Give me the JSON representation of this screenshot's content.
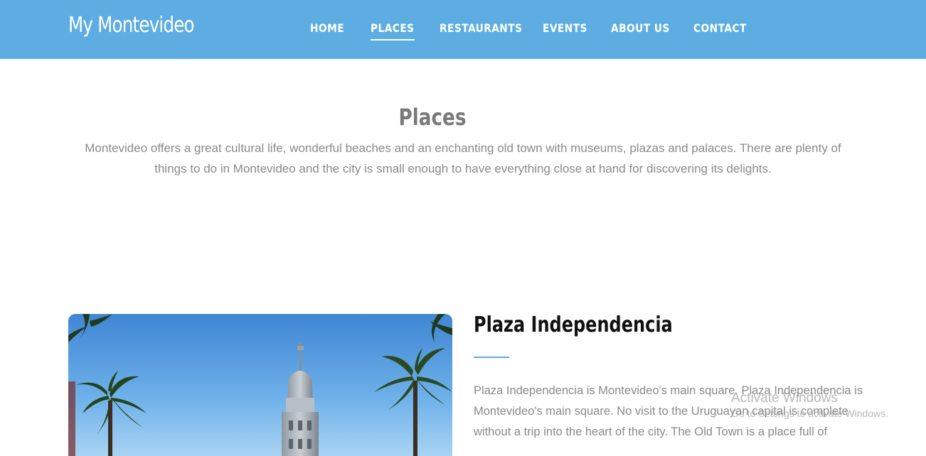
{
  "brand": "My Montevideo",
  "nav": [
    {
      "label": "HOME",
      "active": false
    },
    {
      "label": "PLACES",
      "active": true
    },
    {
      "label": "RESTAURANTS",
      "active": false
    },
    {
      "label": "EVENTS",
      "active": false
    },
    {
      "label": "ABOUT US",
      "active": false
    },
    {
      "label": "CONTACT",
      "active": false
    }
  ],
  "section": {
    "title": "Places",
    "intro": "Montevideo offers a great cultural life, wonderful beaches and an enchanting old town with museums, plazas and palaces. There are plenty of things to do in Montevideo and the city is small enough to have everything close at hand for discovering its delights."
  },
  "place": {
    "title": "Plaza Independencia",
    "description": "Plaza Independencia is Montevideo's main square. Plaza Independencia is Montevideo's main square. No visit to the Uruguayan capital is complete without a trip into the heart of the city. The Old Town is a place full of"
  },
  "watermark": {
    "title": "Activate Windows",
    "subtitle": "Go to Settings to activate Windows."
  },
  "colors": {
    "nav_bg": "#5dade2",
    "accent": "#5dade2",
    "sky": "#4a90d9"
  }
}
